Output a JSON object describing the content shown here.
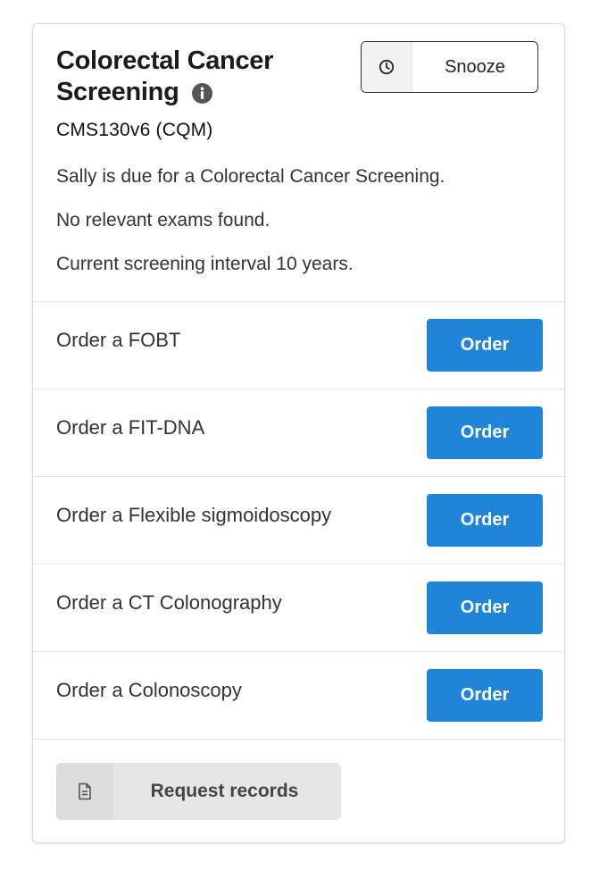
{
  "card": {
    "title_line1": "Colorectal Cancer",
    "title_line2": "Screening",
    "measure": "CMS130v6  (CQM)",
    "snooze_label": "Snooze",
    "descriptions": [
      "Sally is due for a Colorectal Cancer Screening.",
      "No relevant exams found.",
      "Current screening interval 10 years."
    ],
    "orders": [
      {
        "label": "Order a FOBT",
        "button": "Order"
      },
      {
        "label": "Order a FIT-DNA",
        "button": "Order"
      },
      {
        "label": "Order a Flexible sigmoidoscopy",
        "button": "Order"
      },
      {
        "label": "Order a CT Colonography",
        "button": "Order"
      },
      {
        "label": "Order a Colonoscopy",
        "button": "Order"
      }
    ],
    "request_records_label": "Request records"
  },
  "icons": {
    "info": "info-icon",
    "snooze": "clock-icon",
    "records": "document-icon"
  },
  "colors": {
    "primary": "#2085d6",
    "records_bg": "#e6e6e6"
  }
}
